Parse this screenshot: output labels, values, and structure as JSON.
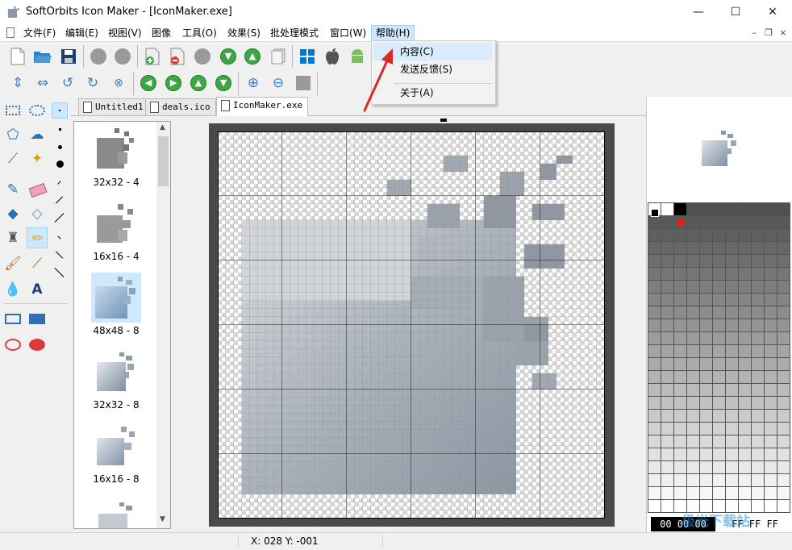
{
  "window": {
    "title": "SoftOrbits Icon Maker - [IconMaker.exe]",
    "controls": {
      "minimize": "—",
      "maximize": "☐",
      "close": "✕"
    }
  },
  "menu": {
    "items": [
      "文件(F)",
      "编辑(E)",
      "视图(V)",
      "图像",
      "工具(O)",
      "效果(S)",
      "批处理模式",
      "窗口(W)",
      "帮助(H)"
    ],
    "active": "帮助(H)",
    "mdi_controls": {
      "minimize": "–",
      "restore": "❐",
      "close": "×"
    }
  },
  "help_menu": {
    "items": [
      "内容(C)",
      "发送反馈(S)",
      "关于(A)"
    ],
    "highlighted": "内容(C)"
  },
  "tabs": [
    {
      "label": "Untitled1",
      "active": false
    },
    {
      "label": "deals.ico",
      "active": false
    },
    {
      "label": "IconMaker.exe",
      "active": true
    }
  ],
  "sizes": [
    {
      "label": "32x32 - 4"
    },
    {
      "label": "16x16 - 4"
    },
    {
      "label": "48x48 - 8",
      "selected": true
    },
    {
      "label": "32x32 - 8"
    },
    {
      "label": "16x16 - 8"
    }
  ],
  "status": {
    "coords": "X: 028 Y: -001"
  },
  "color_values": {
    "primary": "00 00 00",
    "secondary": "FF FF FF"
  },
  "watermark": "极光下载站",
  "colors": {
    "accent": "#cde8ff",
    "green": "#3da843",
    "win_blue": "#0078d7",
    "android": "#78c257",
    "arrow": "#d92a2a"
  }
}
